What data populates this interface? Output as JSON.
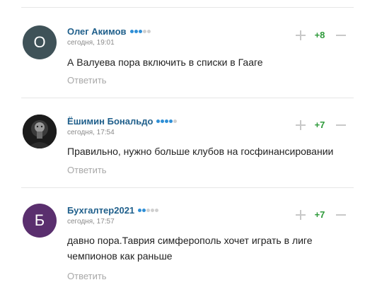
{
  "comments": [
    {
      "author": "Олег Акимов",
      "avatar_letter": "О",
      "avatar_color": "#3f5258",
      "rating_dots": [
        true,
        true,
        true,
        false,
        false
      ],
      "time": "сегодня, 19:01",
      "text": "А Валуева пора включить в списки в Гааге",
      "score": "+8",
      "reply_label": "Ответить"
    },
    {
      "author": "Ёшимин Бональдо",
      "avatar_letter": "",
      "avatar_color": "#1a1a1a",
      "rating_dots": [
        true,
        true,
        true,
        true,
        false
      ],
      "time": "сегодня, 17:54",
      "text": "Правильно, нужно больше клубов на госфинансировании",
      "score": "+7",
      "reply_label": "Ответить"
    },
    {
      "author": "Бухгалтер2021",
      "avatar_letter": "Б",
      "avatar_color": "#5a2f6e",
      "rating_dots": [
        true,
        true,
        false,
        false,
        false
      ],
      "time": "сегодня, 17:57",
      "text": "давно пора.Таврия симферополь хочет играть в лиге чемпионов как раньше",
      "score": "+7",
      "reply_label": "Ответить"
    }
  ]
}
